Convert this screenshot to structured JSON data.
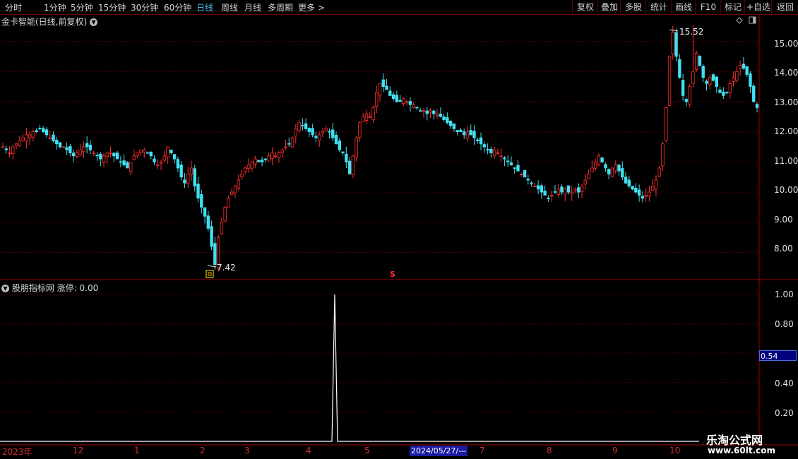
{
  "toolbar": {
    "periods": [
      "分时",
      "1分钟",
      "5分钟",
      "15分钟",
      "30分钟",
      "60分钟",
      "日线",
      "周线",
      "月线",
      "多周期",
      "更多"
    ],
    "active_period": "日线",
    "more_arrow": ">",
    "right_buttons": [
      "复权",
      "叠加",
      "多股",
      "统计",
      "画线",
      "F10",
      "标记",
      "+自选",
      "返回"
    ]
  },
  "main_chart": {
    "title": "金卡智能(日线,前复权)",
    "high_label": "15.52",
    "low_label": "7.42",
    "marker_s": "S",
    "y_ticks": [
      "15.00",
      "14.00",
      "13.00",
      "12.00",
      "11.00",
      "10.00",
      "9.00",
      "8.00"
    ]
  },
  "sub_chart": {
    "title": "股朋指标网",
    "series_label": "涨停: 0.00",
    "y_ticks": [
      "1.00",
      "0.80",
      "0.40",
      "0.20"
    ],
    "cursor_value": "0.54"
  },
  "x_axis": {
    "labels": [
      "2023年",
      "12",
      "1",
      "2",
      "3",
      "4",
      "5",
      "7",
      "8",
      "9",
      "10"
    ],
    "cursor_date": "2024/05/27/—"
  },
  "watermark": {
    "line1": "乐淘公式网",
    "line2": "www.60lt.com"
  },
  "colors": {
    "up": "#ff3030",
    "down": "#40e0f0",
    "grid": "#8a0000",
    "axis": "#a00000"
  },
  "chart_data": {
    "type": "candlestick",
    "y_range": [
      7.1,
      15.9
    ],
    "high": 15.52,
    "low": 7.42,
    "close_series": [
      11.5,
      11.4,
      11.3,
      11.5,
      11.6,
      11.7,
      11.8,
      11.9,
      11.9,
      12.0,
      12.0,
      12.1,
      12.0,
      11.9,
      11.8,
      11.7,
      11.6,
      11.5,
      11.5,
      11.4,
      11.3,
      11.2,
      11.3,
      11.4,
      11.5,
      11.5,
      11.4,
      11.3,
      11.2,
      11.1,
      11.2,
      11.3,
      11.3,
      11.2,
      11.1,
      11.0,
      10.9,
      10.8,
      11.0,
      11.2,
      11.3,
      11.4,
      11.4,
      11.3,
      11.2,
      11.0,
      10.9,
      11.0,
      11.2,
      11.5,
      11.3,
      11.1,
      10.8,
      10.5,
      10.3,
      10.6,
      10.8,
      10.2,
      9.8,
      9.5,
      9.2,
      8.8,
      8.2,
      7.6,
      8.5,
      9.0,
      9.5,
      9.8,
      10.0,
      10.2,
      10.4,
      10.6,
      10.8,
      10.9,
      11.0,
      11.1,
      11.0,
      11.0,
      11.1,
      11.2,
      11.3,
      11.2,
      11.3,
      11.4,
      11.5,
      11.6,
      11.8,
      12.1,
      12.3,
      12.2,
      12.1,
      12.0,
      11.9,
      11.8,
      11.9,
      12.0,
      12.1,
      12.0,
      11.8,
      11.6,
      11.4,
      11.3,
      11.0,
      10.6,
      11.2,
      11.8,
      12.3,
      12.5,
      12.6,
      12.5,
      12.8,
      13.3,
      13.6,
      13.5,
      13.4,
      13.2,
      13.1,
      13.0,
      13.0,
      13.1,
      13.0,
      12.9,
      12.9,
      12.8,
      12.7,
      12.7,
      12.6,
      12.7,
      12.6,
      12.6,
      12.5,
      12.4,
      12.3,
      12.2,
      12.1,
      12.0,
      12.0,
      11.9,
      12.0,
      11.9,
      11.8,
      11.7,
      11.6,
      11.5,
      11.4,
      11.3,
      11.4,
      11.3,
      11.2,
      11.1,
      11.0,
      10.9,
      10.8,
      10.7,
      10.6,
      10.5,
      10.4,
      10.3,
      10.2,
      10.1,
      10.0,
      9.9,
      9.8,
      9.9,
      10.0,
      10.1,
      10.0,
      10.1,
      10.0,
      10.0,
      10.1,
      10.0,
      10.2,
      10.4,
      10.6,
      10.8,
      11.0,
      11.2,
      11.0,
      10.8,
      10.6,
      10.8,
      10.9,
      10.7,
      10.5,
      10.3,
      10.2,
      10.1,
      10.0,
      9.9,
      9.8,
      9.9,
      10.0,
      10.2,
      10.4,
      10.8,
      11.6,
      12.8,
      14.5,
      15.3,
      14.5,
      13.8,
      13.2,
      13.0,
      13.5,
      14.0,
      14.6,
      14.2,
      13.8,
      13.6,
      13.8,
      13.7,
      13.5,
      13.3,
      13.2,
      13.3,
      13.6,
      13.8,
      14.0,
      14.2,
      14.1,
      13.9,
      13.5,
      13.0,
      12.8
    ],
    "limit_up_spike": {
      "date": "2024/05/27",
      "value": 1.0
    }
  }
}
